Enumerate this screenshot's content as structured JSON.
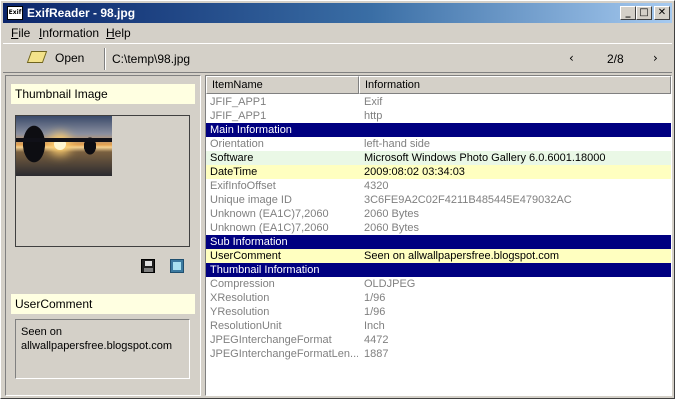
{
  "window": {
    "title": "ExifReader - 98.jpg",
    "icon_text": "Exif",
    "controls": {
      "minimize": "_",
      "maximize": "□",
      "close": "✕"
    }
  },
  "menu": {
    "file_u": "F",
    "file_rest": "ile",
    "info_u": "I",
    "info_rest": "nformation",
    "help_u": "H",
    "help_rest": "elp"
  },
  "toolbar": {
    "open_label": "Open",
    "path": "C:\\temp\\98.jpg",
    "prev": "‹",
    "page": "2/8",
    "next": "›"
  },
  "left_panel": {
    "thumbnail_label": "Thumbnail Image",
    "user_comment_label": "UserComment",
    "user_comment_value_1": "Seen on",
    "user_comment_value_2": "allwallpapersfree.blogspot.com"
  },
  "list": {
    "columns": {
      "name": "ItemName",
      "info": "Information"
    },
    "rows": [
      {
        "name": "JFIF_APP1",
        "value": "Exif",
        "style": "gray"
      },
      {
        "name": "JFIF_APP1",
        "value": "http",
        "style": "gray"
      },
      {
        "name": "Main Information",
        "value": "",
        "style": "section"
      },
      {
        "name": "Orientation",
        "value": "left-hand side",
        "style": "gray"
      },
      {
        "name": "Software",
        "value": "Microsoft Windows Photo Gallery 6.0.6001.18000",
        "style": "hl-green"
      },
      {
        "name": "DateTime",
        "value": "2009:08:02 03:34:03",
        "style": "hl-yellow"
      },
      {
        "name": "ExifInfoOffset",
        "value": "4320",
        "style": "gray"
      },
      {
        "name": "Unique image ID",
        "value": "3C6FE9A2C02F4211B485445E479032AC",
        "style": "gray"
      },
      {
        "name": "Unknown (EA1C)7,2060",
        "value": "2060 Bytes",
        "style": "gray"
      },
      {
        "name": "Unknown (EA1C)7,2060",
        "value": "2060 Bytes",
        "style": "gray"
      },
      {
        "name": "Sub Information",
        "value": "",
        "style": "section"
      },
      {
        "name": "UserComment",
        "value": "Seen on allwallpapersfree.blogspot.com",
        "style": "hl-yellow"
      },
      {
        "name": "Thumbnail Information",
        "value": "",
        "style": "section"
      },
      {
        "name": "Compression",
        "value": "OLDJPEG",
        "style": "gray"
      },
      {
        "name": "XResolution",
        "value": "1/96",
        "style": "gray"
      },
      {
        "name": "YResolution",
        "value": "1/96",
        "style": "gray"
      },
      {
        "name": "ResolutionUnit",
        "value": "Inch",
        "style": "gray"
      },
      {
        "name": "JPEGInterchangeFormat",
        "value": "4472",
        "style": "gray"
      },
      {
        "name": "JPEGInterchangeFormatLen...",
        "value": "1887",
        "style": "gray"
      }
    ]
  }
}
